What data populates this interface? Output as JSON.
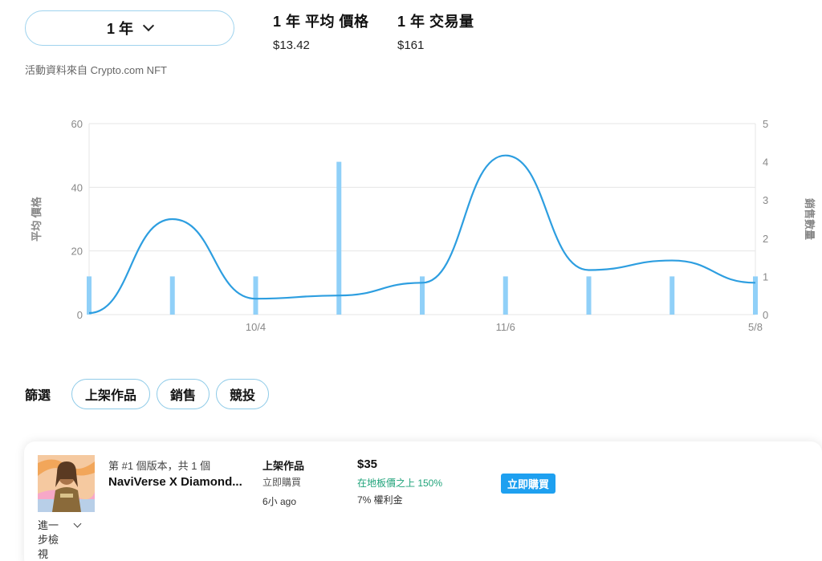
{
  "time_range": {
    "selected": "1 年"
  },
  "stats": {
    "avg_price_label": "1 年 平均 價格",
    "avg_price_value": "$13.42",
    "volume_label": "1 年 交易量",
    "volume_value": "$161"
  },
  "source_note": "活動資料來自 Crypto.com NFT",
  "chart_data": {
    "type": "line",
    "title": "",
    "left_axis": {
      "label": "平均 價格",
      "ticks": [
        0,
        20,
        40,
        60
      ],
      "ylim": [
        0,
        60
      ]
    },
    "right_axis": {
      "label": "銷售數量",
      "ticks": [
        0,
        1,
        2,
        3,
        4,
        5
      ],
      "ylim": [
        0,
        5
      ]
    },
    "x_ticks": [
      {
        "label": "10/4",
        "position_index": 2
      },
      {
        "label": "11/6",
        "position_index": 5
      },
      {
        "label": "5/8",
        "position_index": 8
      }
    ],
    "grid": "horizontal",
    "series": [
      {
        "kind": "line",
        "axis": "left",
        "values": [
          0.5,
          30,
          5,
          6,
          10,
          50,
          14,
          17,
          10
        ],
        "color": "#2d9ee0"
      },
      {
        "kind": "bar",
        "axis": "right",
        "values": [
          1,
          1,
          1,
          4,
          1,
          1,
          1,
          1,
          1
        ],
        "color": "#90d0f8"
      }
    ]
  },
  "filters": {
    "label": "篩選",
    "chips": [
      "上架作品",
      "銷售",
      "競投"
    ]
  },
  "listing": {
    "edition": "第 #1 個版本，共 1 個",
    "name": "NaviVerse X Diamond...",
    "expand_label": "進一步檢視",
    "type_label": "上架作品",
    "type_sub": "立即購買",
    "time_ago": "6小 ago",
    "price": "$35",
    "floor_note": "在地板價之上 150%",
    "royalty": "7% 權利金",
    "buy_label": "立即購買"
  }
}
